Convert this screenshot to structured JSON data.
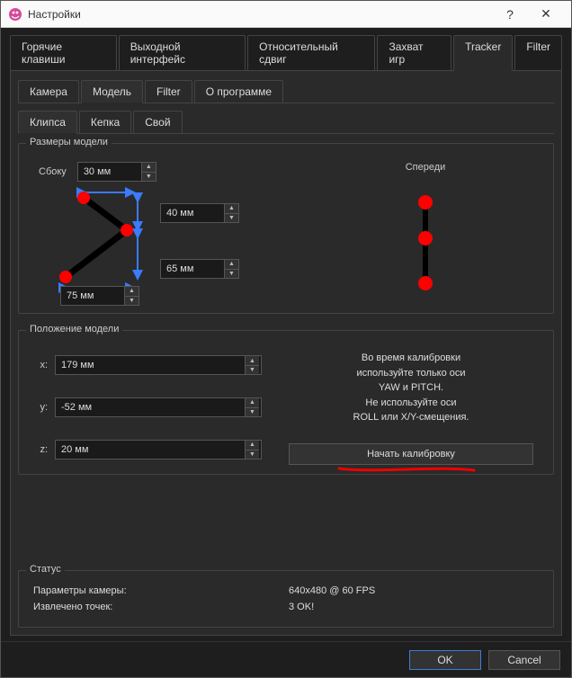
{
  "window": {
    "title": "Настройки"
  },
  "top_tabs": [
    "Горячие клавиши",
    "Выходной интерфейс",
    "Относительный сдвиг",
    "Захват игр",
    "Tracker",
    "Filter"
  ],
  "top_active": 4,
  "inner_tabs": [
    "Камера",
    "Модель",
    "Filter",
    "О программе"
  ],
  "inner_active": 1,
  "sub_tabs": [
    "Клипса",
    "Кепка",
    "Свой"
  ],
  "sub_active": 0,
  "group_model_size": "Размеры модели",
  "side_label": "Сбоку",
  "front_label": "Спереди",
  "dim": {
    "side_top": "30 мм",
    "d1": "40 мм",
    "d2": "65 мм",
    "side_bottom": "75 мм"
  },
  "group_model_pos": "Положение модели",
  "pos": {
    "x_label": "x:",
    "x": "179 мм",
    "y_label": "y:",
    "y": "-52 мм",
    "z_label": "z:",
    "z": "20 мм"
  },
  "calib_note_1": "Во время калибровки",
  "calib_note_2": "используйте только оси",
  "calib_note_3": "YAW и PITCH.",
  "calib_note_4": "Не используйте оси",
  "calib_note_5": "ROLL или X/Y-смещения.",
  "calib_button": "Начать калибровку",
  "status_title": "Статус",
  "status": {
    "cam_label": "Параметры камеры:",
    "cam_value": "640x480 @ 60 FPS",
    "points_label": "Извлечено точек:",
    "points_value": "3 OK!"
  },
  "buttons": {
    "ok": "OK",
    "cancel": "Cancel"
  }
}
